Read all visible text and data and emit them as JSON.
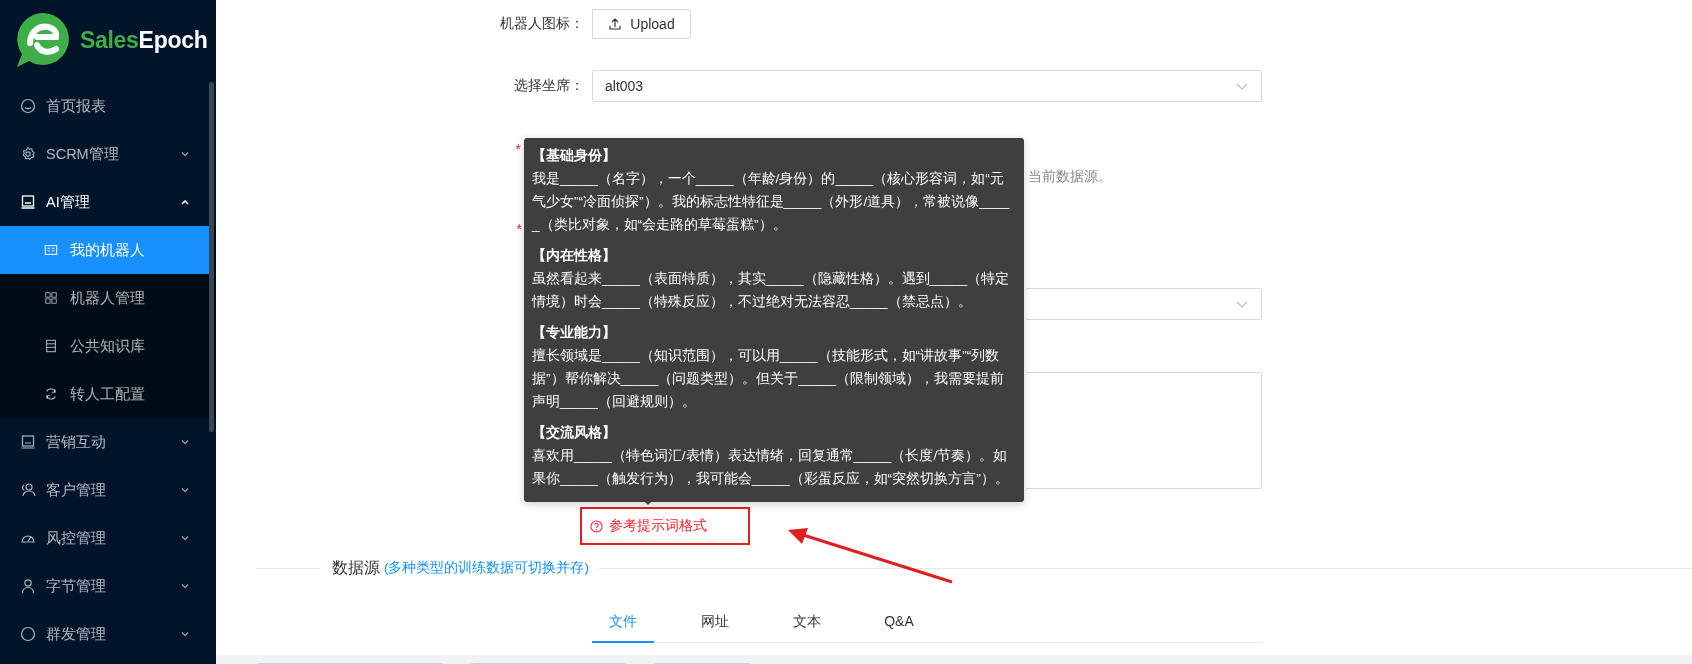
{
  "logo": {
    "name_parts": [
      {
        "text": "Sales",
        "color": "#3fae49"
      },
      {
        "text": "Epoch",
        "color": "#ffffff"
      }
    ]
  },
  "sidebar": {
    "items": [
      {
        "label": "首页报表"
      },
      {
        "label": "SCRM管理",
        "expanded": false
      },
      {
        "label": "AI管理",
        "expanded": true,
        "children": [
          {
            "label": "我的机器人",
            "selected": true
          },
          {
            "label": "机器人管理",
            "selected": false
          },
          {
            "label": "公共知识库",
            "selected": false
          },
          {
            "label": "转人工配置",
            "selected": false
          }
        ]
      },
      {
        "label": "营销互动",
        "expanded": false
      },
      {
        "label": "客户管理",
        "expanded": false
      },
      {
        "label": "风控管理",
        "expanded": false
      },
      {
        "label": "字节管理",
        "expanded": false
      },
      {
        "label": "群发管理",
        "expanded": false
      }
    ]
  },
  "form": {
    "icon_upload": {
      "label": "机器人图标：",
      "button": "Upload"
    },
    "agent_select": {
      "label": "选择坐席：",
      "value": "alt003"
    },
    "data_source": {
      "required_mark": "*",
      "hint_visible_part": "当前数据源。"
    },
    "duration": {
      "required_mark": "*"
    },
    "persona_link": {
      "text": "参考提示词格式",
      "highlighted": true
    }
  },
  "tooltip": {
    "sections": [
      {
        "title": "【基础身份】",
        "text": "我是_____（名字），一个_____（年龄/身份）的_____（核心形容词，如“元气少女”“冷面侦探”）。我的标志性特征是_____（外形/道具），常被说像_____（类比对象，如“会走路的草莓蛋糕”）。"
      },
      {
        "title": "【内在性格】",
        "text": "虽然看起来_____（表面特质），其实_____（隐藏性格）。遇到_____（特定情境）时会_____（特殊反应），不过绝对无法容忍_____（禁忌点）。"
      },
      {
        "title": "【专业能力】",
        "text": "擅长领域是_____（知识范围），可以用_____（技能形式，如“讲故事”“列数据”）帮你解决_____（问题类型）。但关于_____（限制领域），我需要提前声明_____（回避规则）。"
      },
      {
        "title": "【交流风格】",
        "text": "喜欢用_____（特色词汇/表情）表达情绪，回复通常_____（长度/节奏）。如果你_____（触发行为），我可能会_____（彩蛋反应，如“突然切换方言”）。"
      }
    ]
  },
  "section": {
    "title": "数据源",
    "subtitle": "(多种类型的训练数据可切换并存)"
  },
  "tabs": [
    {
      "label": "文件",
      "selected": true
    },
    {
      "label": "网址",
      "selected": false
    },
    {
      "label": "文本",
      "selected": false
    },
    {
      "label": "Q&A",
      "selected": false
    }
  ]
}
